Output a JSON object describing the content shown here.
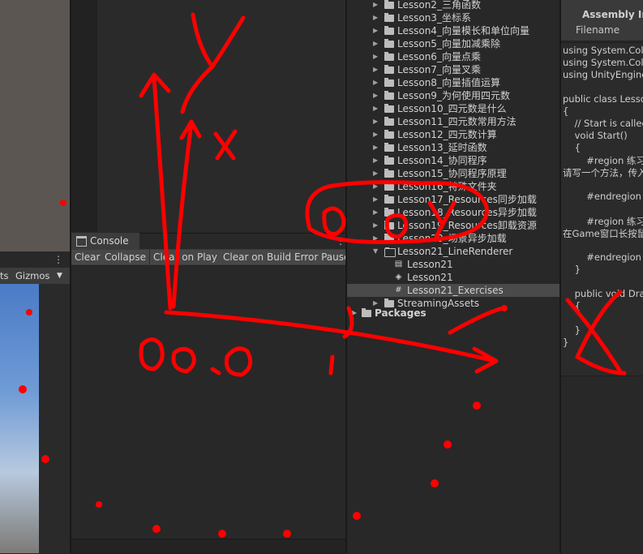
{
  "scene": {
    "toolbar_left": "ts",
    "gizmos_label": "Gizmos",
    "gizmos_arrow": "▼"
  },
  "console": {
    "tab_label": "Console",
    "toolbar": [
      "Clear",
      "Collapse",
      "Clear on Play",
      "Clear on Build",
      "Error Pause"
    ]
  },
  "project": {
    "rows": [
      {
        "label": "Lesson2_三角函数",
        "type": "folder",
        "indent": 1,
        "expand": "▶"
      },
      {
        "label": "Lesson3_坐标系",
        "type": "folder",
        "indent": 1,
        "expand": "▶"
      },
      {
        "label": "Lesson4_向量模长和单位向量",
        "type": "folder",
        "indent": 1,
        "expand": "▶"
      },
      {
        "label": "Lesson5_向量加减乘除",
        "type": "folder",
        "indent": 1,
        "expand": "▶"
      },
      {
        "label": "Lesson6_向量点乘",
        "type": "folder",
        "indent": 1,
        "expand": "▶"
      },
      {
        "label": "Lesson7_向量叉乘",
        "type": "folder",
        "indent": 1,
        "expand": "▶"
      },
      {
        "label": "Lesson8_向量插值运算",
        "type": "folder",
        "indent": 1,
        "expand": "▶"
      },
      {
        "label": "Lesson9_为何使用四元数",
        "type": "folder",
        "indent": 1,
        "expand": "▶"
      },
      {
        "label": "Lesson10_四元数是什么",
        "type": "folder",
        "indent": 1,
        "expand": "▶"
      },
      {
        "label": "Lesson11_四元数常用方法",
        "type": "folder",
        "indent": 1,
        "expand": "▶"
      },
      {
        "label": "Lesson12_四元数计算",
        "type": "folder",
        "indent": 1,
        "expand": "▶"
      },
      {
        "label": "Lesson13_延时函数",
        "type": "folder",
        "indent": 1,
        "expand": "▶"
      },
      {
        "label": "Lesson14_协同程序",
        "type": "folder",
        "indent": 1,
        "expand": "▶"
      },
      {
        "label": "Lesson15_协同程序原理",
        "type": "folder",
        "indent": 1,
        "expand": "▶"
      },
      {
        "label": "Lesson16_特殊文件夹",
        "type": "folder",
        "indent": 1,
        "expand": "▶"
      },
      {
        "label": "Lesson17_Resources同步加载",
        "type": "folder",
        "indent": 1,
        "expand": "▶"
      },
      {
        "label": "Lesson18_Resources异步加载",
        "type": "folder",
        "indent": 1,
        "expand": "▶"
      },
      {
        "label": "Lesson19_Resources卸载资源",
        "type": "folder",
        "indent": 1,
        "expand": "▶"
      },
      {
        "label": "Lesson20_场景异步加载",
        "type": "folder",
        "indent": 1,
        "expand": "▶"
      },
      {
        "label": "Lesson21_LineRenderer",
        "type": "folder-open",
        "indent": 1,
        "expand": "▼"
      },
      {
        "label": "Lesson21",
        "type": "scene",
        "indent": 2,
        "expand": ""
      },
      {
        "label": "Lesson21",
        "type": "unity",
        "indent": 2,
        "expand": ""
      },
      {
        "label": "Lesson21_Exercises",
        "type": "script",
        "indent": 2,
        "expand": "",
        "selected": true
      },
      {
        "label": "StreamingAssets",
        "type": "folder",
        "indent": 1,
        "expand": "▶"
      },
      {
        "label": "Packages",
        "type": "folder",
        "indent": 0,
        "expand": "▶",
        "bold": true
      }
    ]
  },
  "inspector": {
    "title": "Assembly Info",
    "filename_label": "Filename",
    "code": [
      "using System.Coll",
      "using System.Coll",
      "using UnityEngine",
      "",
      "public class Lesso",
      "{",
      "    // Start is called",
      "    void Start()",
      "    {",
      "        #region 练习题",
      "请写一个方法，传入",
      "",
      "        #endregion",
      "",
      "        #region 练习题",
      "在Game窗口长按鼠",
      "",
      "        #endregion",
      "    }",
      "",
      "    public void Draw",
      "    {",
      "",
      "    }",
      "}"
    ]
  },
  "annotations": {
    "y_label": "y",
    "x_label": "x",
    "origin_label": "0,0,0",
    "target_label": "0,0,Y",
    "color": "#ff0000"
  }
}
